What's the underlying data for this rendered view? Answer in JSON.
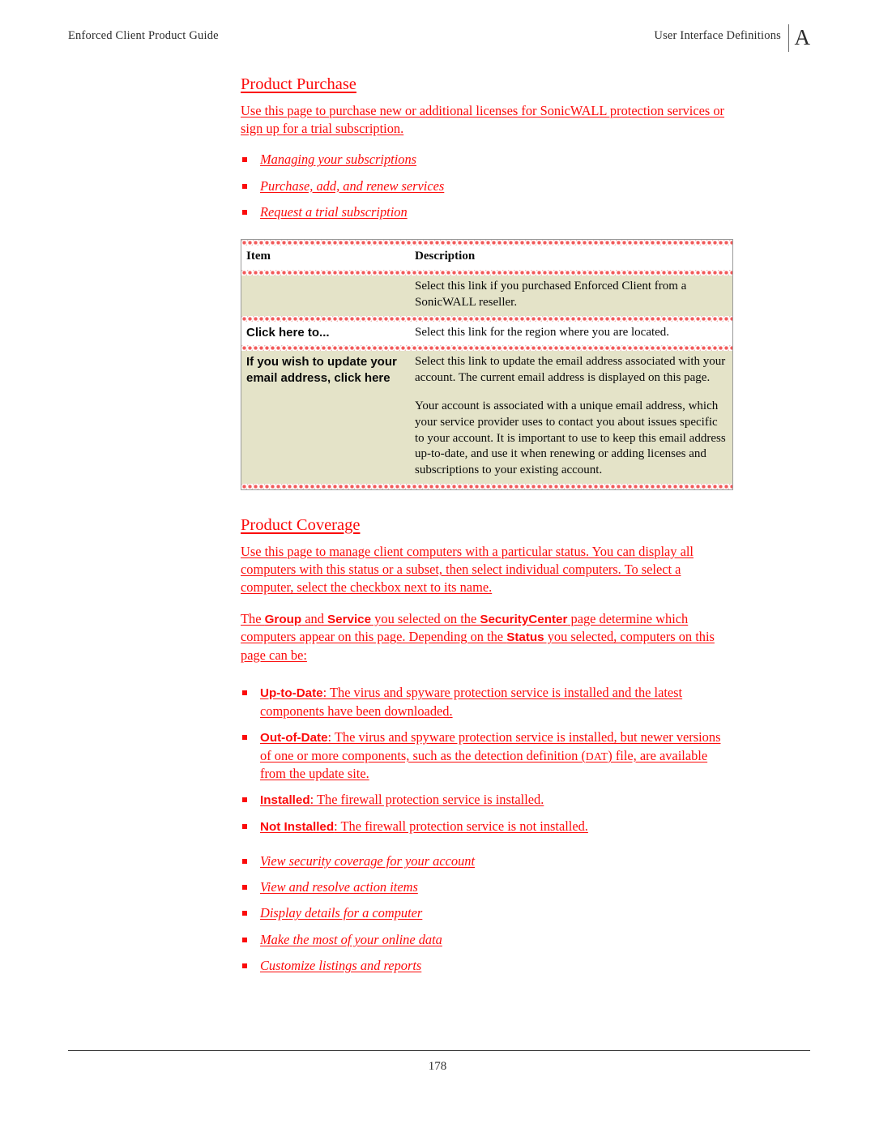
{
  "header": {
    "left_title": "Enforced Client Product Guide",
    "right_title": "User Interface Definitions",
    "appendix_letter": "A"
  },
  "sections": [
    {
      "heading": "Product Purchase",
      "intro": "Use this page to purchase new or additional licenses for SonicWALL protection services or sign up for a trial subscription.",
      "links": [
        "Managing your subscriptions",
        "Purchase, add, and renew services",
        "Request a trial subscription"
      ]
    },
    {
      "heading": "Product Coverage",
      "intro": "Use this page to manage client computers with a particular status. You can display all computers with this status or a subset, then select individual computers. To select a computer, select the checkbox next to its name.",
      "intro2_parts": {
        "t1": "The ",
        "kw1": "Group",
        "t2": " and ",
        "kw2": "Service",
        "t3": " you selected on the ",
        "kw3": "SecurityCenter",
        "t4": " page determine which computers appear on this page. Depending on the ",
        "kw4": "Status",
        "t5": " you selected, computers on this page can be:"
      },
      "status_bullets": [
        {
          "term": "Up-to-Date",
          "rest": ": The virus and spyware protection service is installed and the latest components have been downloaded."
        },
        {
          "term": "Out-of-Date",
          "rest_a": ": The virus and spyware protection service is installed, but newer versions of one or more components, such as the detection definition (",
          "smallcaps": "DAT",
          "rest_b": ") file, are available from the update site."
        },
        {
          "term": "Installed",
          "rest": ": The firewall protection service is installed."
        },
        {
          "term": "Not Installed",
          "rest": ": The firewall protection service is not installed."
        }
      ],
      "links": [
        "View security coverage for your account",
        "View and resolve action items",
        "Display details for a computer",
        "Make the most of your online data",
        "Customize listings and reports"
      ]
    }
  ],
  "table": {
    "columns": [
      "Item",
      "Description"
    ],
    "rows": [
      {
        "item": "",
        "description_paragraphs": [
          "Select this link if you purchased Enforced Client from a SonicWALL reseller."
        ]
      },
      {
        "item": "Click here to...",
        "description_paragraphs": [
          "Select this link for the region where you are located."
        ]
      },
      {
        "item": "If you wish to update your email address, click here",
        "description_paragraphs": [
          "Select this link to update the email address associated with your account. The current email address is displayed on this page.",
          "Your account is associated with a unique email address, which your service provider uses to contact you about issues specific to your account. It is important to use to keep this email address up-to-date, and use it when renewing or adding licenses and subscriptions to your existing account."
        ]
      }
    ]
  },
  "footer": {
    "page_number": "178"
  },
  "colors": {
    "revision_red": "#fb0b0b",
    "table_fill_beige": "#e4e3c8",
    "hatch_red": "#f25a5a",
    "body_black": "#0a0a0a"
  }
}
